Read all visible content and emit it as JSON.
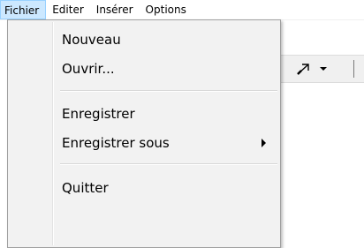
{
  "menubar": {
    "items": [
      {
        "label": "Fichier"
      },
      {
        "label": "Editer"
      },
      {
        "label": "Insérer"
      },
      {
        "label": "Options"
      }
    ]
  },
  "file_menu": {
    "items": [
      {
        "label": "Nouveau"
      },
      {
        "label": "Ouvrir..."
      },
      {
        "label": "Enregistrer"
      },
      {
        "label": "Enregistrer sous",
        "has_submenu": true
      },
      {
        "label": "Quitter"
      }
    ]
  },
  "toolbar": {
    "tool_icon": "diagonal-arrow-icon",
    "dropdown_icon": "chevron-down-icon"
  },
  "colors": {
    "menu_background": "#f2f2f2",
    "menu_border": "#a0a0a0",
    "active_highlight": "#cce8ff"
  }
}
